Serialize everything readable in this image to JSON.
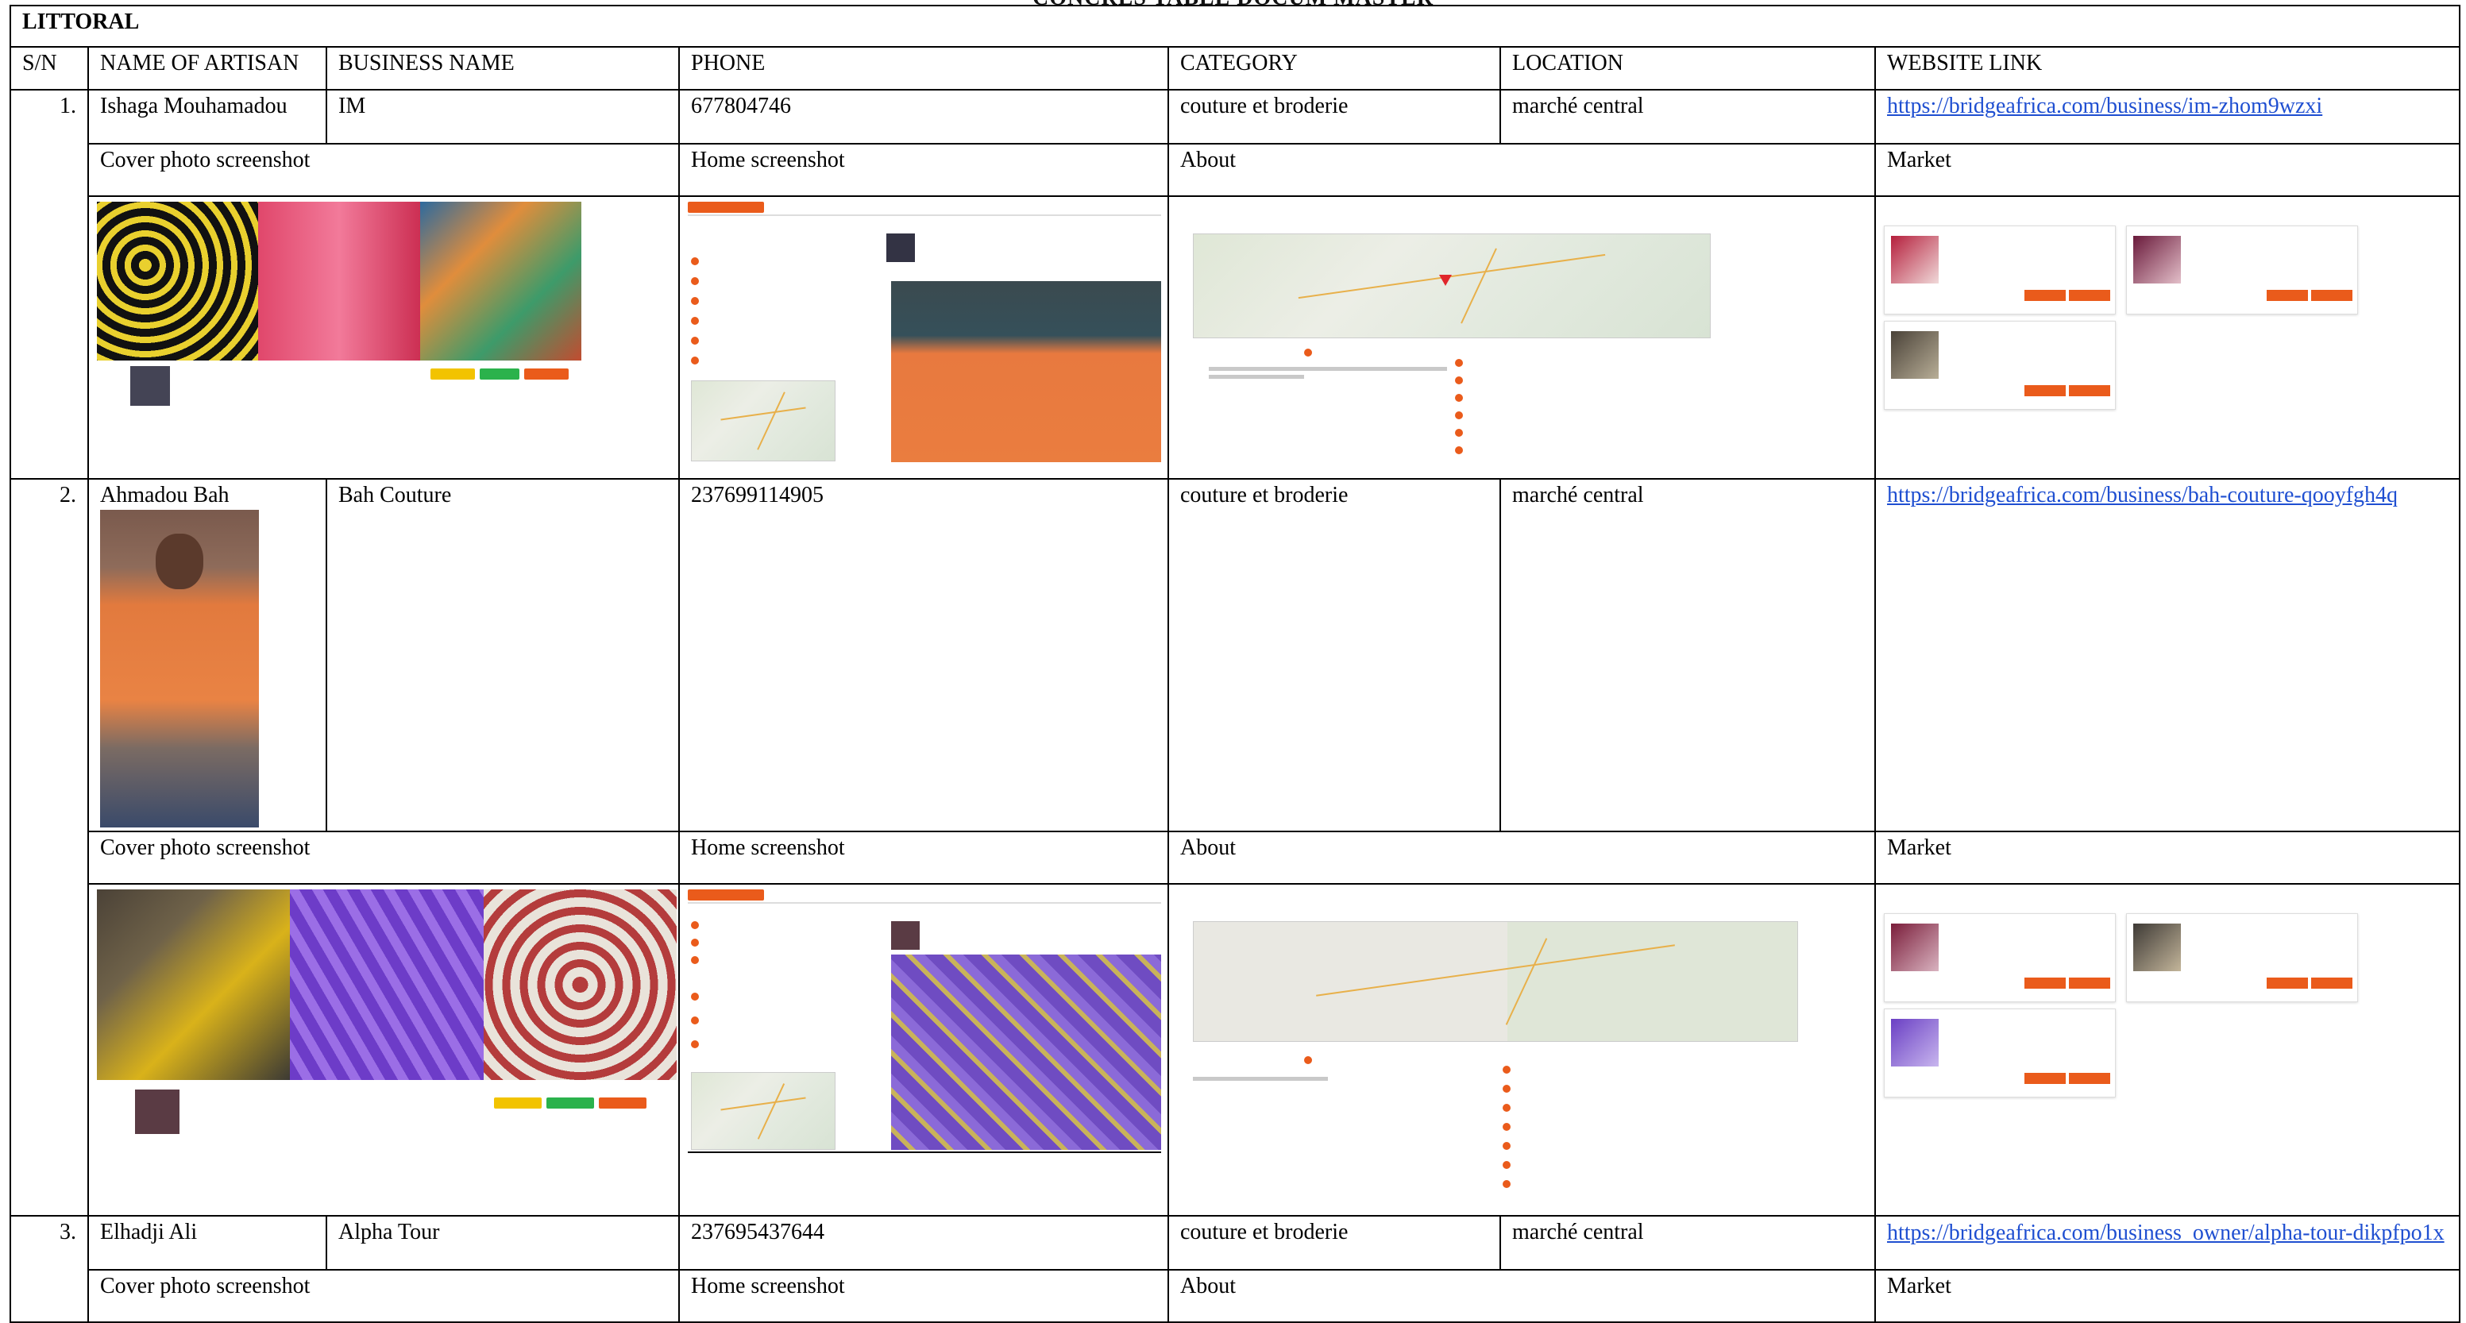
{
  "doc": {
    "title_cut": "CONCRES TABLE DOCUM MASTER",
    "region": "LITTORAL",
    "headers": [
      "S/N",
      "NAME OF ARTISAN",
      "BUSINESS NAME",
      "PHONE",
      "CATEGORY",
      "LOCATION",
      "WEBSITE LINK"
    ],
    "section_labels": {
      "cover": "Cover photo screenshot",
      "home": "Home screenshot",
      "about": "About",
      "market": "Market"
    },
    "rows": [
      {
        "sn": "1.",
        "name": "Ishaga Mouhamadou",
        "business": "IM",
        "phone": "677804746",
        "category": "couture et broderie",
        "location": "marché central",
        "link": "https://bridgeafrica.com/business/im-zhom9wzxi"
      },
      {
        "sn": "2.",
        "name": "Ahmadou Bah",
        "business": "Bah Couture",
        "phone": "237699114905",
        "category": "couture et broderie",
        "location": "marché central",
        "link": "https://bridgeafrica.com/business/bah-couture-qooyfgh4q"
      },
      {
        "sn": "3.",
        "name": "Elhadji Ali",
        "business": "Alpha Tour",
        "phone": "237695437644",
        "category": "couture et broderie",
        "location": "marché central",
        "link": "https://bridgeafrica.com/business_owner/alpha-tour-dikpfpo1x"
      }
    ]
  },
  "colors": {
    "accent_orange": "#ea5b1b",
    "link_blue": "#1f4fd1",
    "border": "#000000"
  }
}
